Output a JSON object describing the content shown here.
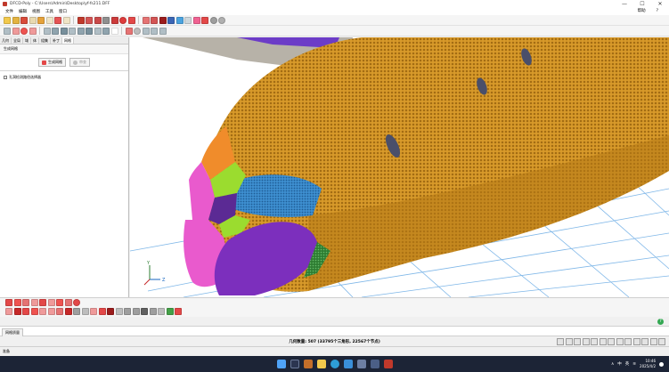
{
  "window": {
    "title": "DFCD-Poly - C:\\Users\\Admin\\Desktop\\yf-fs211.DFF",
    "controls": [
      "—",
      "☐",
      "✕"
    ]
  },
  "menu": {
    "items": [
      "文件",
      "编辑",
      "视图",
      "工具",
      "窗口"
    ],
    "right": [
      "帮助",
      "?"
    ]
  },
  "left_panel": {
    "tabs": [
      {
        "label": "几何"
      },
      {
        "label": "全局"
      },
      {
        "label": "域"
      },
      {
        "label": "体"
      },
      {
        "label": "组集"
      },
      {
        "label": "补丁"
      },
      {
        "label": "网格"
      }
    ],
    "section_title": "生成网格",
    "generate_button": "生成网格",
    "disabled_button": "审查",
    "tree_item": "孔洞检测路径选择器"
  },
  "axis_labels": {
    "y": "Y",
    "z": "Z"
  },
  "log": {
    "tab": "网格质量"
  },
  "status": {
    "stats": "几何数量: 507 (33795个三角形, 22567个节点)",
    "ready": "准备"
  },
  "taskbar": {
    "tray": [
      "∧",
      "中",
      "英"
    ],
    "time": "10:46",
    "date": "2025/4/2"
  },
  "colors": {
    "sky": "#ffffff",
    "grid": "#7fb7e8",
    "fuselage": "#d89a2a",
    "wing": "#6c3cc7",
    "nose_pink": "#e95acd",
    "nose_green": "#9bdc2f",
    "nose_purple": "#7c2fbd",
    "tail_gray": "#b7b2a8"
  }
}
